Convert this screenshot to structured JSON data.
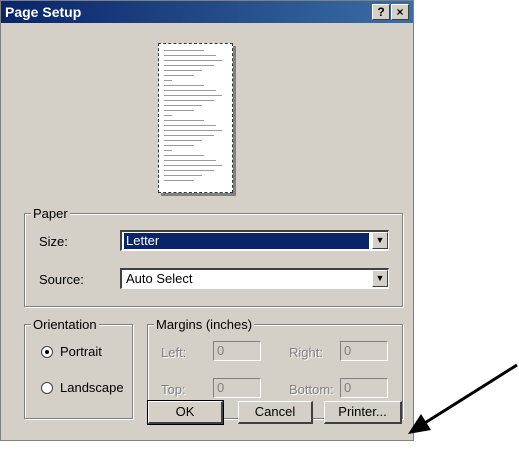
{
  "window": {
    "title": "Page Setup",
    "help_glyph": "?",
    "close_glyph": "×"
  },
  "paper": {
    "group_label": "Paper",
    "size_label": "Size:",
    "size_value": "Letter",
    "source_label": "Source:",
    "source_value": "Auto Select"
  },
  "orientation": {
    "group_label": "Orientation",
    "portrait_label": "Portrait",
    "landscape_label": "Landscape",
    "selected": "Portrait"
  },
  "margins": {
    "group_label": "Margins (inches)",
    "left_label": "Left:",
    "left_value": "0",
    "right_label": "Right:",
    "right_value": "0",
    "top_label": "Top:",
    "top_value": "0",
    "bottom_label": "Bottom:",
    "bottom_value": "0"
  },
  "buttons": {
    "ok": "OK",
    "cancel": "Cancel",
    "printer": "Printer..."
  },
  "colors": {
    "title_bar": "#0a246a",
    "dialog_bg": "#d4d0c8",
    "selection": "#0a246a"
  }
}
